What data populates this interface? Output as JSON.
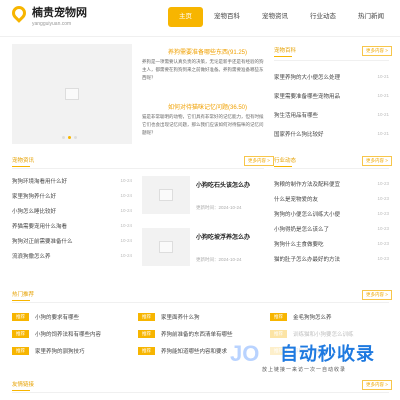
{
  "header": {
    "logo_title": "楠贵宠物网",
    "logo_domain": "yangguiyuan.com",
    "nav": [
      "主页",
      "宠物百科",
      "宠物资讯",
      "行业动态",
      "热门新闻"
    ]
  },
  "featured": {
    "title1": "养狗需要准备哪些东西(91.25)",
    "text1": "养狗是一项需要认真负责的决策，无论是新手还是有经验的狗主人，都需要在狗狗到来之前做好准备。养狗需要准备哪些东西呢？",
    "title2": "如何对待猫咪记忆问题(36.50)",
    "text2": "猫是非常聪明的动物，它们具有非常好的记忆能力，但有时候它们也会出现记忆问题，那么我们应该如何对待猫咪的记忆问题呢？"
  },
  "pet_encyclopedia": {
    "title": "宠物百科",
    "more": "更多内容 >",
    "items": [
      {
        "text": "家里养狗的大小便怎么处理",
        "date": "10-21"
      },
      {
        "text": "家里需要准备哪些宠物用品",
        "date": "10-21"
      },
      {
        "text": "狗生活用品有哪些",
        "date": "10-21"
      },
      {
        "text": "国家养什么狗比较好",
        "date": "10-21"
      }
    ]
  },
  "pet_news": {
    "title": "宠物资讯",
    "more": "更多内容 >",
    "items": [
      {
        "text": "狗狗环境淘看用什么好",
        "date": "10-24"
      },
      {
        "text": "家里狗狗养什么好",
        "date": "10-24"
      },
      {
        "text": "小狗怎么睡比较好",
        "date": "10-24"
      },
      {
        "text": "养猫需要宠用什么淘看",
        "date": "10-24"
      },
      {
        "text": "狗狗对正前需要准备什么",
        "date": "10-24"
      },
      {
        "text": "流浪狗撒怎么养",
        "date": "10-24"
      }
    ],
    "cards": [
      {
        "title": "小狗吃石头该怎么办",
        "date": "更新时间：2024-10-24"
      },
      {
        "title": "小狗吃坡浮养怎么办",
        "date": "更新时间：2024-10-24"
      }
    ]
  },
  "industry": {
    "title": "行业动态",
    "more": "更多内容 >",
    "items": [
      {
        "text": "狗粮的制作方法及配料便宜",
        "date": "10-23"
      },
      {
        "text": "什么是宠物爱的友",
        "date": "10-23"
      },
      {
        "text": "狗狗的小便怎么训练大小便",
        "date": "10-23"
      },
      {
        "text": "小狗得奶是怎么该么了",
        "date": "10-23"
      },
      {
        "text": "狗狗什么主食做要吃",
        "date": "10-23"
      },
      {
        "text": "猫的肚子怎么办最好的方法",
        "date": "10-23"
      }
    ]
  },
  "hot_recommend": {
    "title": "热门推荐",
    "more": "更多内容 >",
    "tag": "推荐",
    "col1": [
      "小狗的要求有哪些",
      "小狗的饲养法和有哪些内容",
      "家里养狗的驯狗技巧"
    ],
    "col2": [
      "家里面养什么狗",
      "养狗前准备的东西清单有哪些",
      "养狗能知道哪些内容和要求"
    ],
    "col3": [
      "金毛狗狗怎么养",
      "训练猫和小狗要怎么训练",
      "养狗的方法"
    ]
  },
  "last_section": {
    "title": "友情链接",
    "more": "更多内容 >"
  },
  "watermark": {
    "logo": "JO",
    "title": "自动秒收录",
    "sub": "放上链接一来访一次一自动收录"
  }
}
